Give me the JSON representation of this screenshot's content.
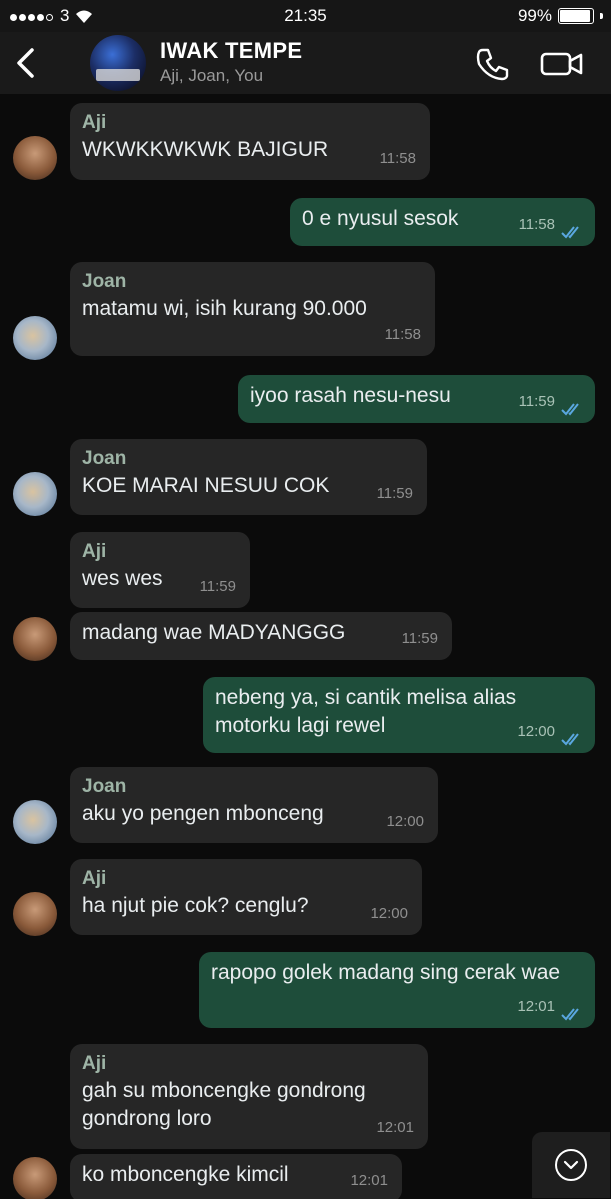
{
  "status_bar": {
    "carrier": "3",
    "time": "21:35",
    "battery": "99%"
  },
  "header": {
    "title": "IWAK TEMPE",
    "subtitle": "Aji, Joan, You"
  },
  "messages": [
    {
      "sender": "Aji",
      "text": "WKWKKWKWK BAJIGUR",
      "time": "11:58"
    },
    {
      "text": "0 e nyusul sesok",
      "time": "11:58"
    },
    {
      "sender": "Joan",
      "text": "matamu wi, isih kurang 90.000",
      "time": "11:58"
    },
    {
      "text": "iyoo rasah nesu-nesu",
      "time": "11:59"
    },
    {
      "sender": "Joan",
      "text": "KOE MARAI NESUU COK",
      "time": "11:59"
    },
    {
      "sender": "Aji",
      "text": "wes wes",
      "time": "11:59"
    },
    {
      "text": "madang wae MADYANGGG",
      "time": "11:59"
    },
    {
      "text": "nebeng ya, si cantik melisa alias motorku lagi rewel",
      "time": "12:00"
    },
    {
      "sender": "Joan",
      "text": "aku yo pengen mbonceng",
      "time": "12:00"
    },
    {
      "sender": "Aji",
      "text": "ha njut pie cok? cenglu?",
      "time": "12:00"
    },
    {
      "text": "rapopo golek madang sing cerak wae",
      "time": "12:01"
    },
    {
      "sender": "Aji",
      "text": "gah su mboncengke gondrong gondrong loro",
      "time": "12:01"
    },
    {
      "text": "ko mboncengke kimcil",
      "time": "12:01"
    }
  ],
  "colors": {
    "incoming": "#262626",
    "outgoing": "#1e4d3a",
    "read_ticks": "#5aa7e0"
  }
}
